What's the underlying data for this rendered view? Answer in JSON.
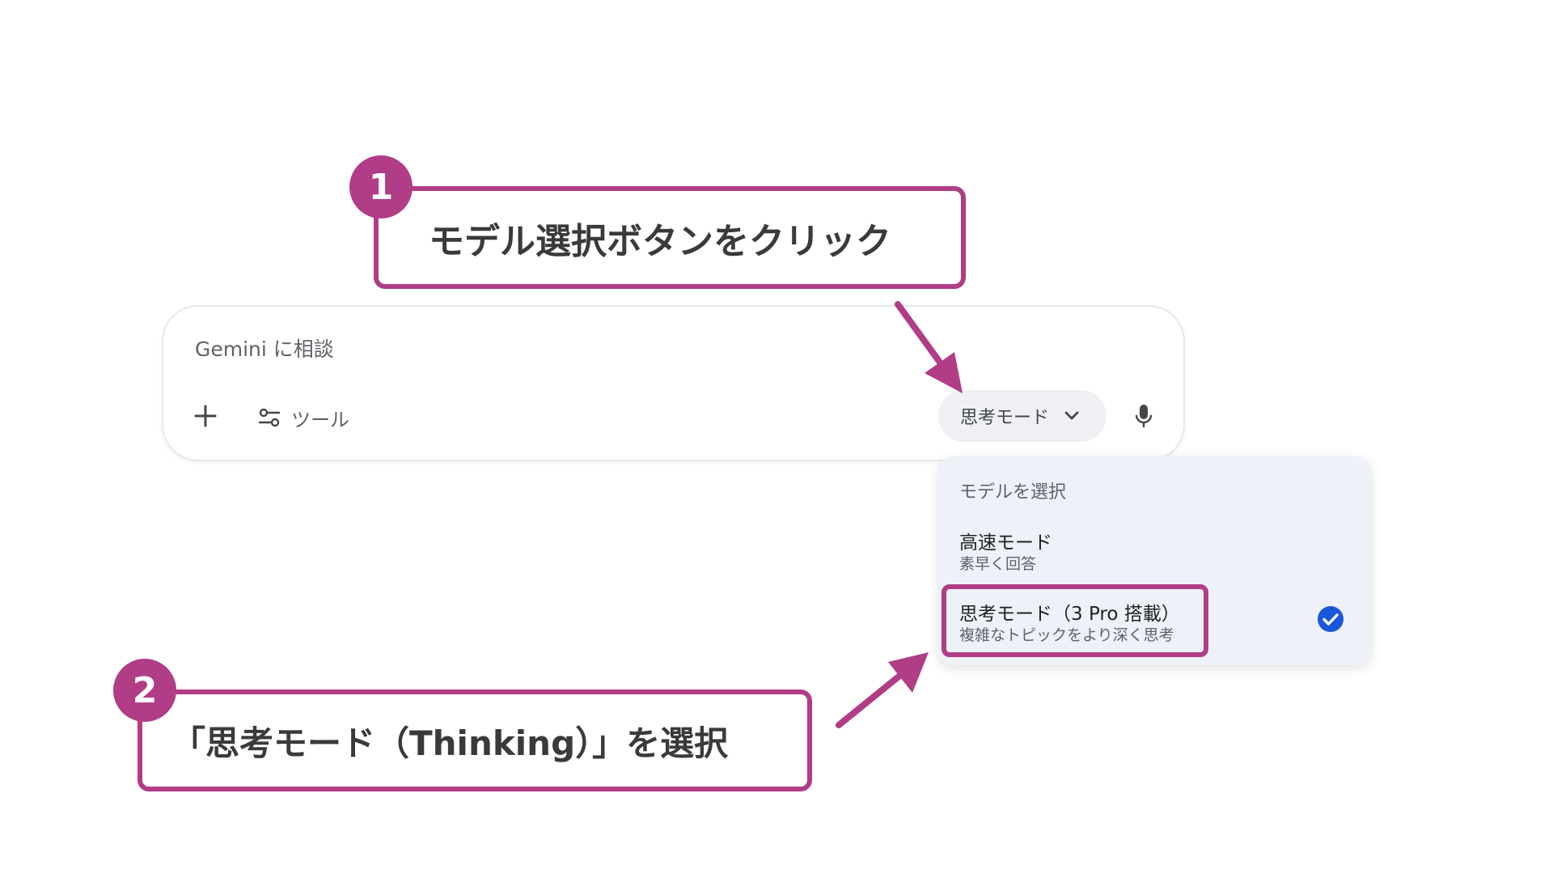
{
  "prompt": {
    "placeholder": "Gemini に相談",
    "tools_label": "ツール",
    "model_button_label": "思考モード"
  },
  "menu": {
    "header": "モデルを選択",
    "options": [
      {
        "label": "高速モード",
        "description": "素早く回答",
        "selected": false
      },
      {
        "label": "思考モード（3 Pro 搭載）",
        "description": "複雑なトピックをより深く思考",
        "selected": true
      }
    ]
  },
  "callouts": [
    {
      "number": "1",
      "text": "モデル選択ボタンをクリック"
    },
    {
      "number": "2",
      "text": "「思考モード（Thinking）」を選択"
    }
  ],
  "colors": {
    "accent": "#b03d86",
    "check": "#1a56db"
  },
  "icons": {
    "plus": "plus-icon",
    "tools": "tools-icon",
    "chevron": "chevron-down-icon",
    "mic": "microphone-icon",
    "check": "check-circle-icon"
  }
}
